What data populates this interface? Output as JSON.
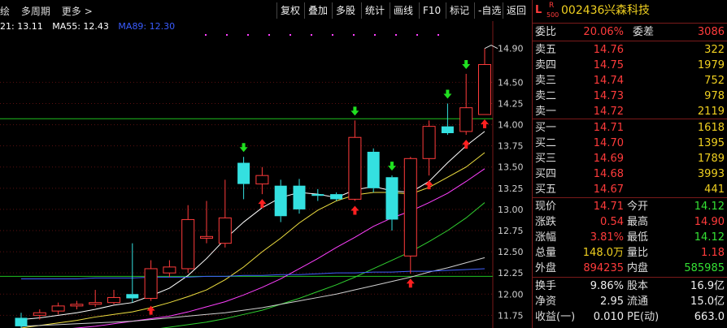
{
  "toolbar": {
    "left_items": [
      "绘",
      "多周期",
      "更多"
    ],
    "more_arrow": ">",
    "buttons": [
      "复权",
      "叠加",
      "多股",
      "统计",
      "画线",
      "F10",
      "标记",
      "-自选",
      "返回"
    ]
  },
  "ma_legend": [
    {
      "label": "21: 13.11",
      "color": "#ffffff"
    },
    {
      "label": "MA55: 12.43",
      "color": "#ffffff"
    },
    {
      "label": "MA89: 12.30",
      "color": "#3a5cff"
    }
  ],
  "colors": {
    "up": "#ff3b3b",
    "down": "#34e0e0",
    "ma5": "#ffffff",
    "ma10": "#f0e040",
    "ma20": "#ff40ff",
    "ma30": "#30d030",
    "ma60": "#d0d0d0",
    "ma120": "#4060ff",
    "hline": "#20c020"
  },
  "chart_data": {
    "type": "candlestick",
    "y_ticks": [
      "14.50",
      "14.25",
      "14.00",
      "13.75",
      "13.50",
      "13.25",
      "13.00",
      "12.75",
      "12.50",
      "12.25",
      "12.00",
      "11.75"
    ],
    "ylim": [
      11.6,
      15.05
    ],
    "high_label": "14.90",
    "high_value": 14.9,
    "reference_lines": [
      14.07,
      12.21
    ],
    "candles": [
      {
        "o": 11.72,
        "c": 11.62,
        "h": 11.78,
        "l": 11.58
      },
      {
        "o": 11.75,
        "c": 11.78,
        "h": 11.82,
        "l": 11.7
      },
      {
        "o": 11.8,
        "c": 11.86,
        "h": 11.9,
        "l": 11.76
      },
      {
        "o": 11.86,
        "c": 11.88,
        "h": 11.92,
        "l": 11.82
      },
      {
        "o": 11.88,
        "c": 11.9,
        "h": 12.05,
        "l": 11.85
      },
      {
        "o": 11.9,
        "c": 11.96,
        "h": 12.05,
        "l": 11.88
      },
      {
        "o": 12.0,
        "c": 11.95,
        "h": 12.6,
        "l": 11.9
      },
      {
        "o": 11.95,
        "c": 12.3,
        "h": 12.4,
        "l": 11.92
      },
      {
        "o": 12.25,
        "c": 12.32,
        "h": 12.4,
        "l": 12.2
      },
      {
        "o": 12.3,
        "c": 12.88,
        "h": 13.05,
        "l": 12.25
      },
      {
        "o": 12.66,
        "c": 12.68,
        "h": 13.1,
        "l": 12.6
      },
      {
        "o": 12.6,
        "c": 12.9,
        "h": 13.35,
        "l": 12.55
      },
      {
        "o": 13.55,
        "c": 13.3,
        "h": 13.62,
        "l": 13.12
      },
      {
        "o": 13.3,
        "c": 13.4,
        "h": 13.5,
        "l": 13.18
      },
      {
        "o": 13.28,
        "c": 12.92,
        "h": 13.35,
        "l": 12.85
      },
      {
        "o": 13.28,
        "c": 13.0,
        "h": 13.36,
        "l": 12.95
      },
      {
        "o": 13.18,
        "c": 13.16,
        "h": 13.24,
        "l": 13.1
      },
      {
        "o": 13.18,
        "c": 13.12,
        "h": 13.2,
        "l": 13.1
      },
      {
        "o": 13.12,
        "c": 13.85,
        "h": 14.05,
        "l": 13.1
      },
      {
        "o": 13.68,
        "c": 13.25,
        "h": 13.72,
        "l": 13.2
      },
      {
        "o": 13.38,
        "c": 12.88,
        "h": 13.4,
        "l": 12.75
      },
      {
        "o": 12.45,
        "c": 13.6,
        "h": 13.62,
        "l": 12.24
      },
      {
        "o": 13.6,
        "c": 13.98,
        "h": 14.05,
        "l": 13.4
      },
      {
        "o": 13.98,
        "c": 13.9,
        "h": 14.25,
        "l": 13.88
      },
      {
        "o": 13.92,
        "c": 14.2,
        "h": 14.6,
        "l": 13.88
      },
      {
        "o": 14.12,
        "c": 14.71,
        "h": 14.9,
        "l": 14.12
      }
    ],
    "up_arrows": [
      7,
      13,
      18,
      21,
      22,
      24,
      25
    ],
    "down_arrows": [
      12,
      18,
      20,
      23,
      24
    ],
    "ma_lines": [
      {
        "name": "MA5",
        "color": "#ffffff",
        "values": [
          11.7,
          11.72,
          11.75,
          11.78,
          11.82,
          11.87,
          11.9,
          11.98,
          12.07,
          12.22,
          12.42,
          12.65,
          12.85,
          13.02,
          13.14,
          13.2,
          13.18,
          13.14,
          13.23,
          13.27,
          13.22,
          13.2,
          13.33,
          13.55,
          13.75,
          13.92
        ]
      },
      {
        "name": "MA10",
        "color": "#f0e040",
        "values": [
          11.6,
          11.63,
          11.66,
          11.69,
          11.73,
          11.76,
          11.79,
          11.84,
          11.9,
          11.97,
          12.05,
          12.17,
          12.32,
          12.5,
          12.66,
          12.84,
          12.99,
          13.1,
          13.17,
          13.2,
          13.2,
          13.18,
          13.26,
          13.38,
          13.5,
          13.67
        ]
      },
      {
        "name": "MA20",
        "color": "#ff40ff",
        "values": [
          11.55,
          11.56,
          11.58,
          11.6,
          11.62,
          11.65,
          11.68,
          11.71,
          11.74,
          11.79,
          11.85,
          11.91,
          11.99,
          12.08,
          12.18,
          12.3,
          12.42,
          12.55,
          12.67,
          12.8,
          12.9,
          12.98,
          13.08,
          13.19,
          13.33,
          13.48
        ]
      },
      {
        "name": "MA30",
        "color": "#30d030",
        "values": [
          11.45,
          11.47,
          11.49,
          11.5,
          11.52,
          11.54,
          11.56,
          11.58,
          11.61,
          11.64,
          11.67,
          11.71,
          11.76,
          11.81,
          11.88,
          11.95,
          12.03,
          12.11,
          12.2,
          12.3,
          12.4,
          12.5,
          12.62,
          12.75,
          12.9,
          13.08
        ]
      },
      {
        "name": "MA55",
        "color": "#d0d0d0",
        "values": [
          11.62,
          11.63,
          11.64,
          11.65,
          11.66,
          11.67,
          11.68,
          11.7,
          11.72,
          11.74,
          11.76,
          11.78,
          11.81,
          11.84,
          11.88,
          11.92,
          11.96,
          12.0,
          12.05,
          12.1,
          12.15,
          12.2,
          12.26,
          12.31,
          12.37,
          12.43
        ]
      },
      {
        "name": "MA89",
        "color": "#4060ff",
        "values": [
          12.18,
          12.18,
          12.18,
          12.18,
          12.19,
          12.19,
          12.19,
          12.2,
          12.2,
          12.2,
          12.21,
          12.21,
          12.22,
          12.22,
          12.23,
          12.23,
          12.24,
          12.25,
          12.25,
          12.26,
          12.26,
          12.27,
          12.27,
          12.28,
          12.29,
          12.3
        ]
      }
    ]
  },
  "quote": {
    "header_l": "L",
    "header_r": "R",
    "header_sub": "500",
    "code": "002436",
    "name": "兴森科技",
    "weibi_label": "委比",
    "weibi_value": "20.06%",
    "weicha_label": "委差",
    "weicha_value": "3086",
    "asks": [
      {
        "label": "卖五",
        "price": "14.76",
        "vol": "322"
      },
      {
        "label": "卖四",
        "price": "14.75",
        "vol": "1979"
      },
      {
        "label": "卖三",
        "price": "14.74",
        "vol": "752"
      },
      {
        "label": "卖二",
        "price": "14.73",
        "vol": "978"
      },
      {
        "label": "卖一",
        "price": "14.72",
        "vol": "2119"
      }
    ],
    "bids": [
      {
        "label": "买一",
        "price": "14.71",
        "vol": "1618"
      },
      {
        "label": "买二",
        "price": "14.70",
        "vol": "1395"
      },
      {
        "label": "买三",
        "price": "14.69",
        "vol": "1789"
      },
      {
        "label": "买四",
        "price": "14.68",
        "vol": "3993"
      },
      {
        "label": "买五",
        "price": "14.67",
        "vol": "441"
      }
    ],
    "stats1": [
      {
        "l1": "现价",
        "v1": "14.71",
        "c1": "red",
        "l2": "今开",
        "v2": "14.12",
        "c2": "green"
      },
      {
        "l1": "涨跌",
        "v1": "0.54",
        "c1": "red",
        "l2": "最高",
        "v2": "14.90",
        "c2": "red"
      },
      {
        "l1": "涨幅",
        "v1": "3.81%",
        "c1": "red",
        "l2": "最低",
        "v2": "14.12",
        "c2": "green"
      },
      {
        "l1": "总量",
        "v1": "148.0万",
        "c1": "yellow",
        "l2": "量比",
        "v2": "1.18",
        "c2": "red"
      },
      {
        "l1": "外盘",
        "v1": "894235",
        "c1": "red",
        "l2": "内盘",
        "v2": "585985",
        "c2": "green"
      }
    ],
    "stats2": [
      {
        "l1": "换手",
        "v1": "9.86%",
        "l2": "股本",
        "v2": "16.9亿"
      },
      {
        "l1": "净资",
        "v1": "2.95",
        "l2": "流通",
        "v2": "15.0亿"
      },
      {
        "l1": "收益(一)",
        "v1": "0.010",
        "l2": "PE(动)",
        "v2": "663.0"
      }
    ]
  }
}
